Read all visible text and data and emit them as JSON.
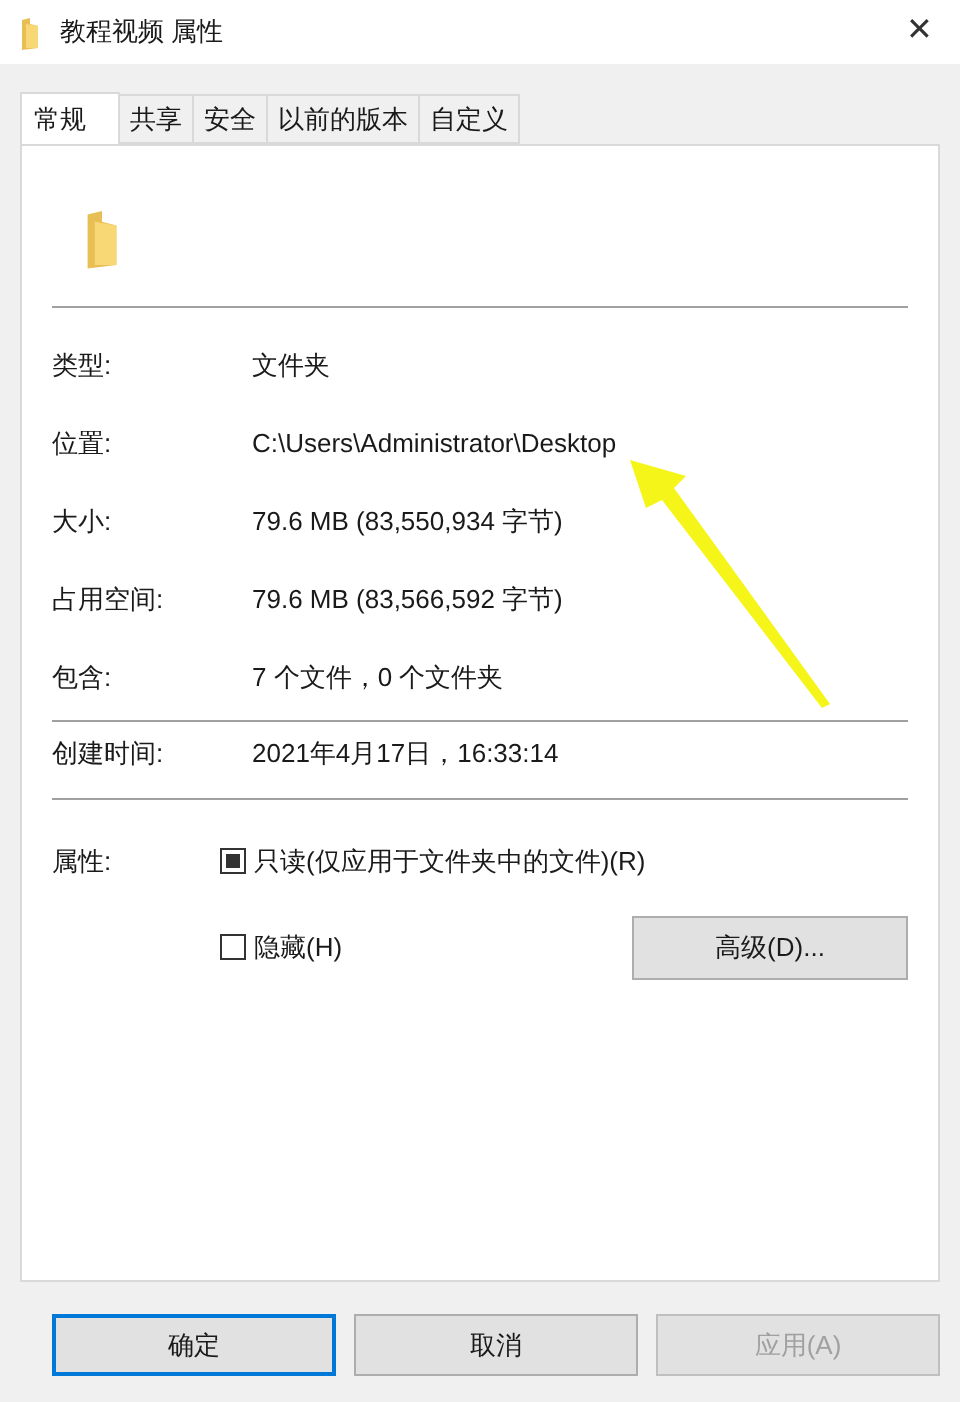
{
  "window": {
    "title": "教程视频 属性",
    "close": "✕"
  },
  "tabs": [
    {
      "label": "常规",
      "selected": true
    },
    {
      "label": "共享",
      "selected": false
    },
    {
      "label": "安全",
      "selected": false
    },
    {
      "label": "以前的版本",
      "selected": false
    },
    {
      "label": "自定义",
      "selected": false
    }
  ],
  "groups": [
    [
      {
        "label": "类型:",
        "value": "文件夹"
      },
      {
        "label": "位置:",
        "value": "C:\\Users\\Administrator\\Desktop"
      },
      {
        "label": "大小:",
        "value": "79.6 MB (83,550,934 字节)"
      },
      {
        "label": "占用空间:",
        "value": "79.6 MB (83,566,592 字节)"
      },
      {
        "label": "包含:",
        "value": "7 个文件，0 个文件夹"
      }
    ],
    [
      {
        "label": "创建时间:",
        "value": "2021年4月17日，16:33:14"
      }
    ]
  ],
  "attributes": {
    "label": "属性:",
    "options": [
      {
        "label": "只读(仅应用于文件夹中的文件)(R)",
        "checked": false,
        "mixed": true
      },
      {
        "label": "隐藏(H)",
        "checked": false,
        "mixed": false
      }
    ],
    "advanced": "高级(D)..."
  },
  "buttons": [
    {
      "label": "确定",
      "default": true,
      "disabled": false
    },
    {
      "label": "取消",
      "default": false,
      "disabled": false
    },
    {
      "label": "应用(A)",
      "default": false,
      "disabled": true
    }
  ]
}
